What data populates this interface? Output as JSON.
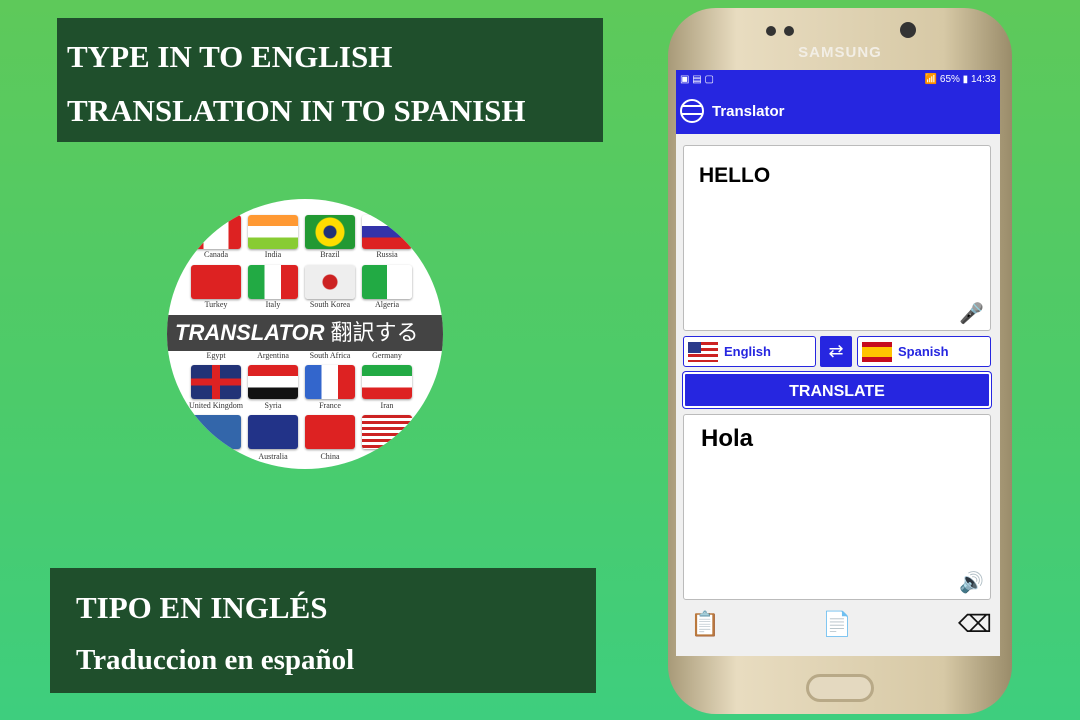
{
  "captions": {
    "top": [
      "TYPE IN TO ENGLISH",
      "TRANSLATION IN TO SPANISH"
    ],
    "bottom": [
      "TIPO EN INGLÉS",
      "Traduccion en español"
    ]
  },
  "logo": {
    "banner": "TRANSLATOR",
    "banner_jp": "翻訳する",
    "flags": [
      [
        "Canada",
        "India",
        "Brazil",
        "Russia"
      ],
      [
        "Turkey",
        "Italy",
        "South Korea",
        "Algeria"
      ],
      [
        "Egypt",
        "Argentina",
        "South Africa",
        "Germany"
      ],
      [
        "United Kingdom",
        "Syria",
        "France",
        "Iran"
      ],
      [
        "",
        "Australia",
        "China",
        ""
      ]
    ]
  },
  "phone": {
    "brand": "SAMSUNG",
    "status": {
      "battery": "65%",
      "time": "14:33"
    },
    "app": {
      "title": "Translator",
      "input_text": "HELLO",
      "source_lang": "English",
      "target_lang": "Spanish",
      "translate_label": "TRANSLATE",
      "output_text": "Hola"
    }
  },
  "colors": {
    "accent": "#2626e0",
    "caption_bg": "#1f4f2c"
  }
}
